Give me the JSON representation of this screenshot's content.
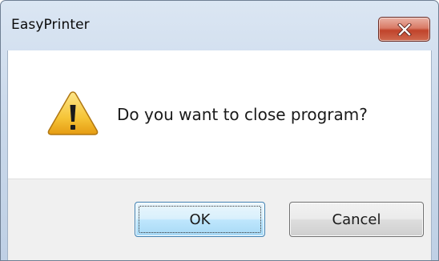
{
  "window": {
    "title": "EasyPrinter",
    "close_icon": "close-x-icon"
  },
  "dialog": {
    "icon": "warning-icon",
    "message": "Do you want to close program?"
  },
  "buttons": {
    "ok_label": "OK",
    "cancel_label": "Cancel"
  },
  "colors": {
    "close_button": "#c9513a",
    "ok_border": "#3c7fb1",
    "warning_fill": "#f6c538"
  }
}
